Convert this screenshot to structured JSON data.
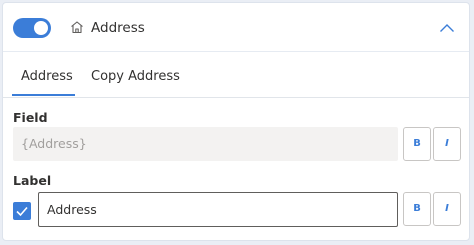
{
  "header": {
    "title": "Address",
    "toggle_on": true
  },
  "tabs": [
    {
      "label": "Address",
      "active": true
    },
    {
      "label": "Copy Address",
      "active": false
    }
  ],
  "field": {
    "label": "Field",
    "placeholder": "{Address}",
    "bold_label": "B",
    "italic_label": "I"
  },
  "label_section": {
    "label": "Label",
    "value": "Address",
    "checked": true,
    "bold_label": "B",
    "italic_label": "I"
  },
  "colors": {
    "accent": "#3b7dd8",
    "field_bg": "#f3f2f1",
    "page_bg": "#eaeef5"
  }
}
